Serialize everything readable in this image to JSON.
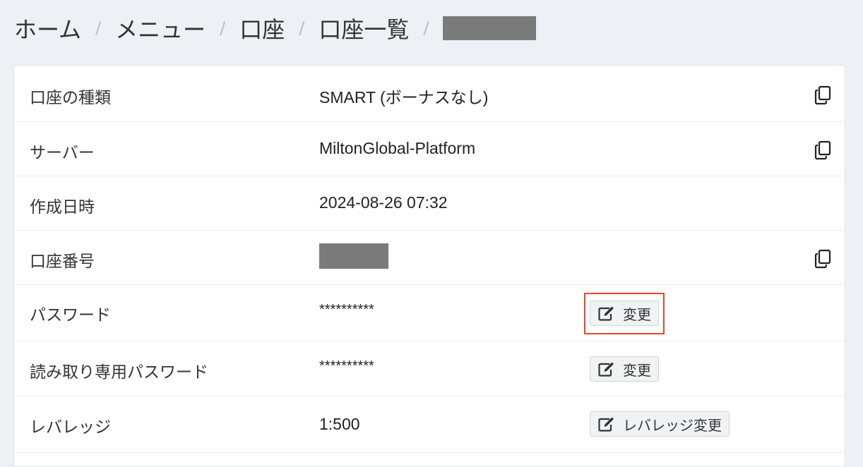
{
  "breadcrumb": {
    "items": [
      "ホーム",
      "メニュー",
      "口座",
      "口座一覧"
    ],
    "separator": "/"
  },
  "rows": [
    {
      "label": "口座の種類",
      "value": "SMART (ボーナスなし)"
    },
    {
      "label": "サーバー",
      "value": "MiltonGlobal-Platform"
    },
    {
      "label": "作成日時",
      "value": "2024-08-26 07:32"
    },
    {
      "label": "口座番号"
    },
    {
      "label": "パスワード",
      "value": "**********",
      "button": "変更"
    },
    {
      "label": "読み取り専用パスワード",
      "value": "**********",
      "button": "変更"
    },
    {
      "label": "レバレッジ",
      "value": "1:500",
      "button": "レバレッジ変更"
    }
  ],
  "icons": {
    "copy": "copy-icon",
    "edit": "edit-icon"
  },
  "colors": {
    "page_background": "#edf0f5",
    "highlight_border": "#e0472f",
    "redaction": "#7a7a7a"
  }
}
